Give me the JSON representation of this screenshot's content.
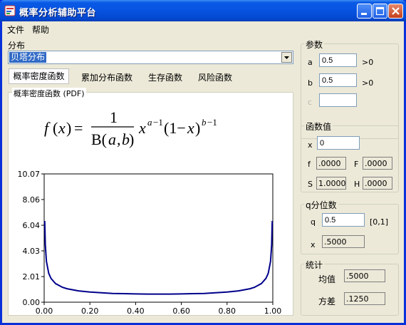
{
  "window": {
    "title": "概率分析辅助平台"
  },
  "menu": {
    "items": [
      {
        "label": "文件"
      },
      {
        "label": "帮助"
      }
    ]
  },
  "distribution": {
    "label": "分布",
    "selected": "贝塔分布"
  },
  "tabs": [
    {
      "label": "概率密度函数",
      "active": true
    },
    {
      "label": "累加分布函数",
      "active": false
    },
    {
      "label": "生存函数",
      "active": false
    },
    {
      "label": "风险函数",
      "active": false
    }
  ],
  "pdf_panel": {
    "title": "概率密度函数 (PDF)"
  },
  "params": {
    "title": "参数",
    "a": {
      "label": "a",
      "value": "0.5",
      "constraint": ">0"
    },
    "b": {
      "label": "b",
      "value": "0.5",
      "constraint": ">0"
    },
    "c": {
      "label": "c",
      "value": ""
    }
  },
  "func_values": {
    "title": "函数值",
    "x": {
      "label": "x",
      "value": "0"
    },
    "f": {
      "label": "f",
      "value": ".0000"
    },
    "F": {
      "label": "F",
      "value": ".0000"
    },
    "S": {
      "label": "S",
      "value": "1.0000"
    },
    "H": {
      "label": "H",
      "value": ".0000"
    }
  },
  "quantile": {
    "title": "q分位数",
    "q": {
      "label": "q",
      "value": "0.5",
      "range": "[0,1]"
    },
    "x": {
      "label": "x",
      "value": ".5000"
    }
  },
  "stats": {
    "title": "统计",
    "mean": {
      "label": "均值",
      "value": ".5000"
    },
    "variance": {
      "label": "方差",
      "value": ".1250"
    }
  },
  "colors": {
    "curve": "#00008b",
    "titlebar": "#0a5ae6",
    "client": "#ece9d8"
  },
  "chart_data": {
    "type": "line",
    "x_ticks": [
      "0.00",
      "0.20",
      "0.40",
      "0.60",
      "0.80",
      "1.00"
    ],
    "y_ticks": [
      "0.00",
      "2.01",
      "4.03",
      "6.04",
      "8.06",
      "10.07"
    ],
    "xlim": [
      0,
      1
    ],
    "ylim": [
      0,
      10.07
    ],
    "series": [
      {
        "x": [
          0.0025,
          0.005,
          0.01,
          0.02,
          0.03,
          0.05,
          0.08,
          0.1,
          0.15,
          0.2,
          0.25,
          0.3,
          0.35,
          0.4,
          0.45,
          0.5,
          0.55,
          0.6,
          0.65,
          0.7,
          0.75,
          0.8,
          0.85,
          0.9,
          0.92,
          0.95,
          0.97,
          0.98,
          0.99,
          0.995,
          0.9975
        ],
        "y": [
          6.38,
          4.51,
          3.2,
          2.27,
          1.87,
          1.46,
          1.17,
          1.06,
          0.89,
          0.8,
          0.74,
          0.69,
          0.67,
          0.65,
          0.64,
          0.64,
          0.64,
          0.65,
          0.67,
          0.69,
          0.74,
          0.8,
          0.89,
          1.06,
          1.17,
          1.46,
          1.87,
          2.27,
          3.2,
          4.51,
          6.38
        ]
      }
    ]
  }
}
